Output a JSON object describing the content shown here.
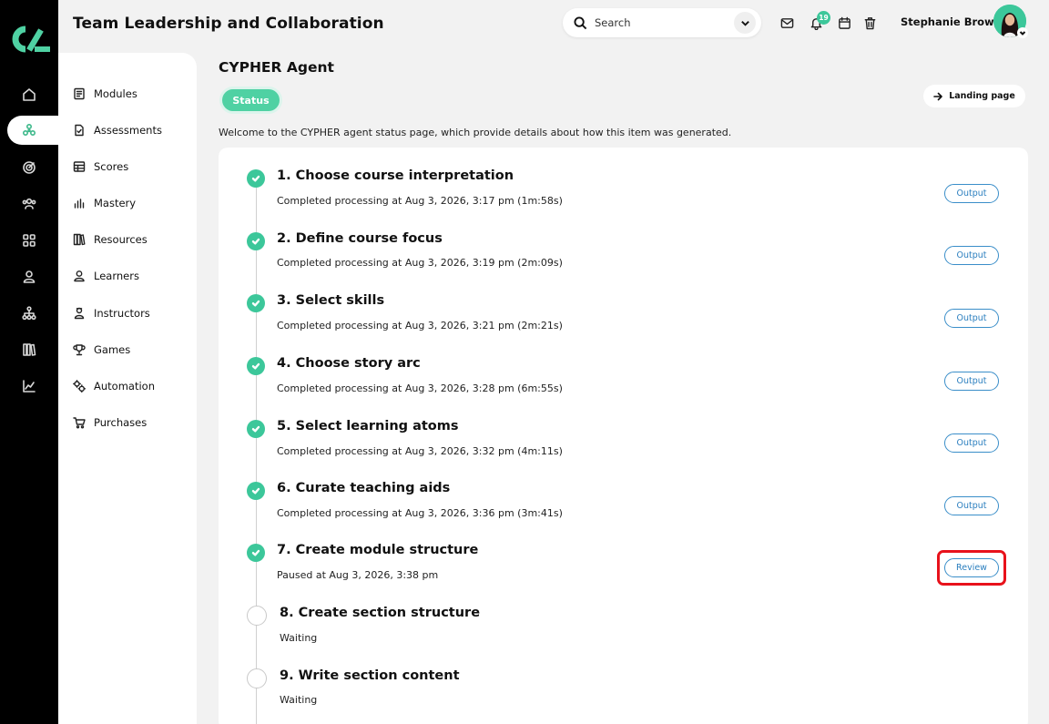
{
  "app": {
    "title": "Team Leadership and Collaboration"
  },
  "header": {
    "search_placeholder": "Search",
    "notification_count": "19",
    "user_name": "Stephanie Brown"
  },
  "rail": {
    "items": [
      "home-icon",
      "modules-network-icon",
      "target-icon",
      "users-icon",
      "grid-icon",
      "user-icon",
      "hierarchy-icon",
      "library-icon",
      "chart-icon"
    ],
    "active_index": 1
  },
  "sidebar": {
    "items": [
      {
        "label": "Modules",
        "icon": "book-icon"
      },
      {
        "label": "Assessments",
        "icon": "document-icon"
      },
      {
        "label": "Scores",
        "icon": "table-icon"
      },
      {
        "label": "Mastery",
        "icon": "bar-chart-icon"
      },
      {
        "label": "Resources",
        "icon": "books-icon"
      },
      {
        "label": "Learners",
        "icon": "person-icon"
      },
      {
        "label": "Instructors",
        "icon": "instructor-icon"
      },
      {
        "label": "Games",
        "icon": "trophy-icon"
      },
      {
        "label": "Automation",
        "icon": "gears-icon"
      },
      {
        "label": "Purchases",
        "icon": "cart-icon"
      }
    ]
  },
  "main": {
    "page_title": "CYPHER Agent",
    "status_tab": "Status",
    "landing_button": "Landing page",
    "intro": "Welcome to the CYPHER agent status page, which provide details about how this item was generated.",
    "steps": [
      {
        "title": "1. Choose course interpretation",
        "status": "Completed processing at Aug 3, 2026, 3:17 pm (1m:58s)",
        "state": "done",
        "action": "Output"
      },
      {
        "title": "2. Define course focus",
        "status": "Completed processing at Aug 3, 2026, 3:19 pm (2m:09s)",
        "state": "done",
        "action": "Output"
      },
      {
        "title": "3. Select skills",
        "status": "Completed processing at Aug 3, 2026, 3:21 pm (2m:21s)",
        "state": "done",
        "action": "Output"
      },
      {
        "title": "4. Choose story arc",
        "status": "Completed processing at Aug 3, 2026, 3:28 pm (6m:55s)",
        "state": "done",
        "action": "Output"
      },
      {
        "title": "5. Select learning atoms",
        "status": "Completed processing at Aug 3, 2026, 3:32 pm (4m:11s)",
        "state": "done",
        "action": "Output"
      },
      {
        "title": "6. Curate teaching aids",
        "status": "Completed processing at Aug 3, 2026, 3:36 pm (3m:41s)",
        "state": "done",
        "action": "Output"
      },
      {
        "title": "7. Create module structure",
        "status": "Paused at Aug 3, 2026, 3:38 pm",
        "state": "paused",
        "action": "Review"
      },
      {
        "title": "8. Create section structure",
        "status": "Waiting",
        "state": "waiting",
        "action": ""
      },
      {
        "title": "9. Write section content",
        "status": "Waiting",
        "state": "waiting",
        "action": ""
      }
    ]
  },
  "colors": {
    "accent": "#3cc79a",
    "link": "#2b7fbf",
    "highlight": "#e8121b"
  }
}
